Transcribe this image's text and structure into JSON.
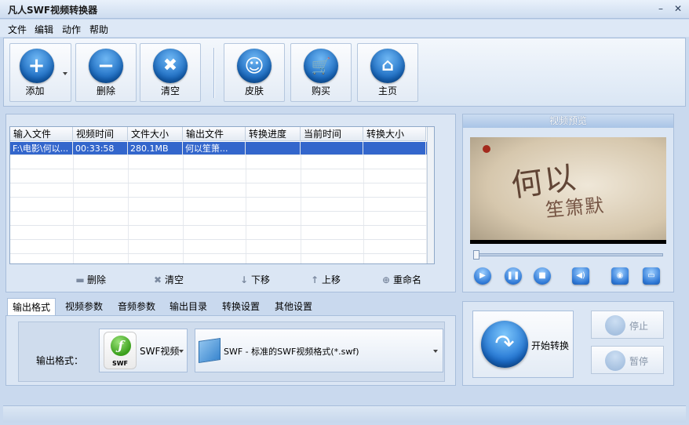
{
  "window": {
    "title": "凡人SWF视频转换器"
  },
  "menu": [
    "文件",
    "编辑",
    "动作",
    "帮助"
  ],
  "toolbar": {
    "add": "添加",
    "delete": "删除",
    "clear": "清空",
    "skin": "皮肤",
    "buy": "购买",
    "home": "主页"
  },
  "table": {
    "columns": [
      "输入文件",
      "视频时间",
      "文件大小",
      "输出文件",
      "转换进度",
      "当前时间",
      "转换大小"
    ],
    "rows": [
      [
        "F:\\电影\\何以...",
        "00:33:58",
        "280.1MB",
        "何以笙箫...",
        "",
        "",
        ""
      ]
    ]
  },
  "list_actions": {
    "delete": "删除",
    "clear": "清空",
    "move_down": "下移",
    "move_up": "上移",
    "rename": "重命名"
  },
  "preview": {
    "header": "视频预览",
    "title_art": "何以",
    "title_art2": "笙箫默"
  },
  "tabs": [
    "输出格式",
    "视频参数",
    "音频参数",
    "输出目录",
    "转换设置",
    "其他设置"
  ],
  "output": {
    "label": "输出格式：",
    "format_btn": "SWF视频",
    "format_icon_text": "SWF",
    "format_select": "SWF - 标准的SWF视频格式(*.swf)"
  },
  "controls": {
    "start": "开始转换",
    "stop": "停止",
    "pause": "暂停"
  },
  "colors": {
    "accent": "#3366cc",
    "background": "#c9d9ee"
  }
}
